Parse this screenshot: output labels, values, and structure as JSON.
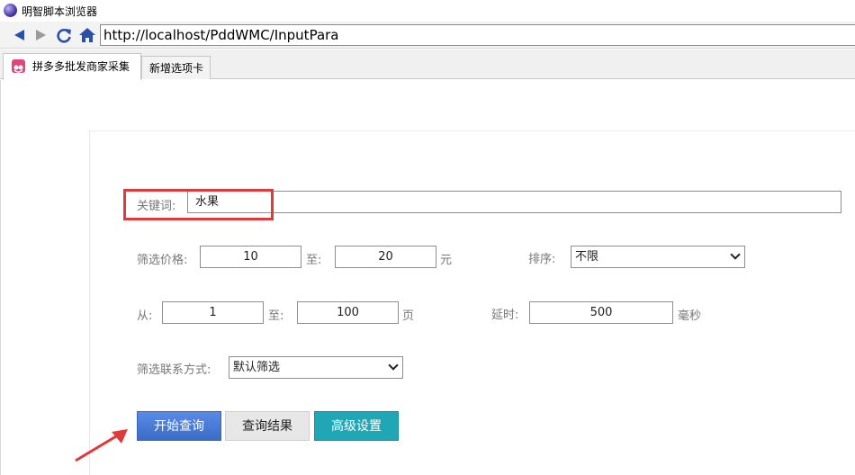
{
  "window": {
    "title": "明智脚本浏览器"
  },
  "nav": {
    "back": "back-icon",
    "forward": "forward-icon",
    "refresh": "refresh-icon",
    "home": "home-icon",
    "address": "http://localhost/PddWMC/InputPara"
  },
  "tabs": [
    {
      "label": "拼多多批发商家采集",
      "active": true
    },
    {
      "label": "新增选项卡",
      "active": false
    }
  ],
  "form": {
    "keyword_label": "关键词:",
    "keyword_value": "水果",
    "price_label": "筛选价格:",
    "price_min": "10",
    "to_label": "至:",
    "price_max": "20",
    "price_unit": "元",
    "sort_label": "排序:",
    "sort_value": "不限",
    "page_from_label": "从:",
    "page_from": "1",
    "page_to_label": "至:",
    "page_to": "100",
    "page_unit": "页",
    "delay_label": "延时:",
    "delay_value": "500",
    "delay_unit": "毫秒",
    "contact_label": "筛选联系方式:",
    "contact_value": "默认筛选"
  },
  "buttons": {
    "start": "开始查询",
    "results": "查询结果",
    "advanced": "高级设置"
  },
  "colors": {
    "start_btn": "#4a7bd6",
    "results_btn": "#e6e6e6",
    "advanced_btn": "#21a8b5",
    "highlight": "#e0393a"
  }
}
